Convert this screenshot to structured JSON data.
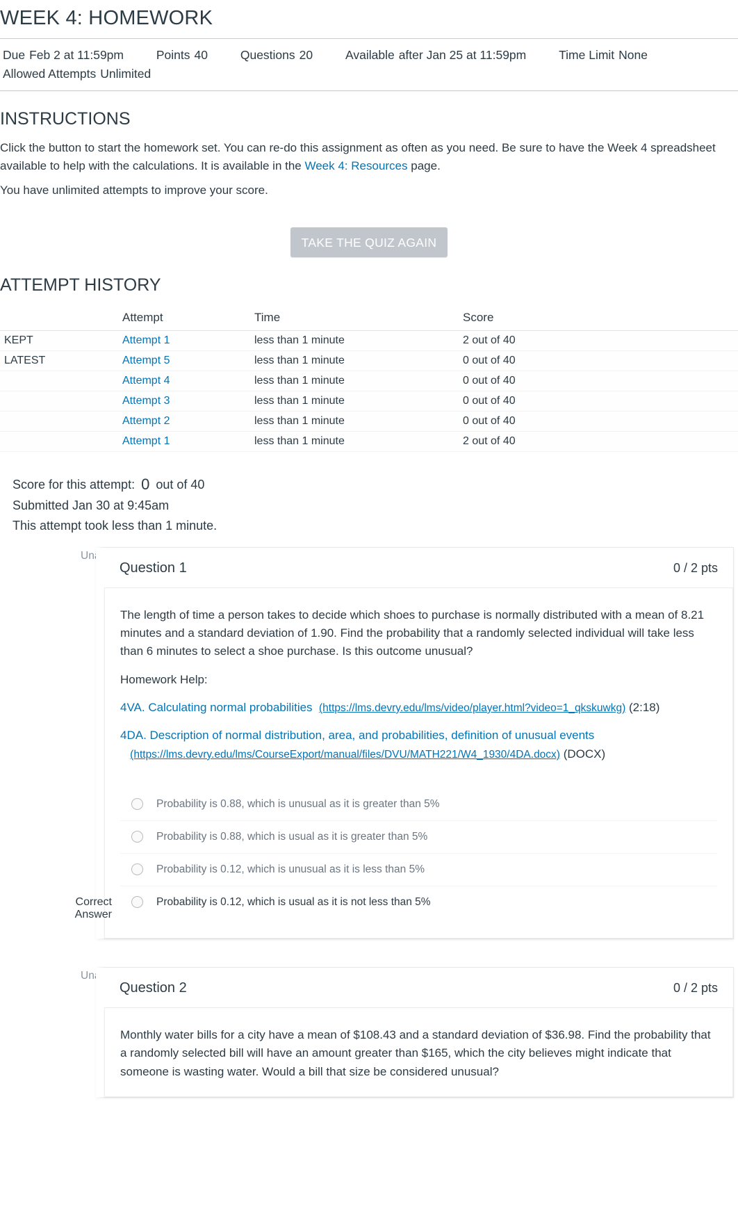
{
  "title": "WEEK 4: HOMEWORK",
  "meta": {
    "due_label": "Due",
    "due_value": "Feb 2 at 11:59pm",
    "points_label": "Points",
    "points_value": "40",
    "questions_label": "Questions",
    "questions_value": "20",
    "available_label": "Available",
    "available_value": "after Jan 25 at 11:59pm",
    "timelimit_label": "Time Limit",
    "timelimit_value": "None",
    "attempts_label": "Allowed Attempts",
    "attempts_value": "Unlimited"
  },
  "instructions_heading": "INSTRUCTIONS",
  "instructions_p1a": "Click the button to start the homework set. You can re-do this assignment as often as you need. Be sure to have the Week 4 spreadsheet available to help with the calculations. It is available in the ",
  "instructions_link": "Week 4: Resources",
  "instructions_p1b": " page.",
  "instructions_p2": "You have unlimited attempts to improve your score.",
  "take_again_button": "TAKE THE QUIZ AGAIN",
  "history_heading": "ATTEMPT HISTORY",
  "history_headers": {
    "attempt": "Attempt",
    "time": "Time",
    "score": "Score"
  },
  "history_rows": [
    {
      "tag": "KEPT",
      "attempt": "Attempt 1",
      "time": "less than 1 minute",
      "score": "2 out of 40"
    },
    {
      "tag": "LATEST",
      "attempt": "Attempt 5",
      "time": "less than 1 minute",
      "score": "0 out of 40"
    },
    {
      "tag": "",
      "attempt": "Attempt 4",
      "time": "less than 1 minute",
      "score": "0 out of 40"
    },
    {
      "tag": "",
      "attempt": "Attempt 3",
      "time": "less than 1 minute",
      "score": "0 out of 40"
    },
    {
      "tag": "",
      "attempt": "Attempt 2",
      "time": "less than 1 minute",
      "score": "0 out of 40"
    },
    {
      "tag": "",
      "attempt": "Attempt 1",
      "time": "less than 1 minute",
      "score": "2 out of 40"
    }
  ],
  "score_block": {
    "line1a": "Score for this attempt:",
    "line1_big": "0",
    "line1b": "out of 40",
    "line2": "Submitted Jan 30 at 9:45am",
    "line3": "This attempt took less than 1 minute."
  },
  "q1": {
    "gutter": "Unanswered",
    "heading": "Question 1",
    "pts": "0 / 2 pts",
    "text": "The length of time a person takes to decide which shoes to purchase is normally distributed with a mean of 8.21 minutes and a standard deviation of 1.90. Find the probability that a randomly selected individual will take less than 6 minutes to select a shoe purchase. Is this outcome unusual?",
    "help_label": "Homework Help:",
    "link1_text": "4VA. Calculating normal probabilities",
    "link1_url": "(https://lms.devry.edu/lms/video/player.html?video=1_qkskuwkg)",
    "link1_suffix": " (2:18)",
    "link2_text": "4DA. Description of normal distribution, area, and probabilities, definition of unusual events",
    "link2_url": "(https://lms.devry.edu/lms/CourseExport/manual/files/DVU/MATH221/W4_1930/4DA.docx)",
    "link2_suffix": " (DOCX)",
    "answers": [
      "Probability is 0.88, which is unusual as it is greater than 5%",
      "Probability is 0.88, which is usual as it is greater than 5%",
      "Probability is 0.12, which is unusual as it is less than 5%",
      "Probability is 0.12, which is usual as it is not less than 5%"
    ],
    "correct_label": "Correct Answer"
  },
  "q2": {
    "gutter": "Unanswered",
    "heading": "Question 2",
    "pts": "0 / 2 pts",
    "text": "Monthly water bills for a city have a mean of $108.43 and a standard deviation of $36.98. Find the probability that a randomly selected bill will have an amount greater than $165, which the city believes might indicate that someone is wasting water. Would a bill that size be considered unusual?"
  }
}
